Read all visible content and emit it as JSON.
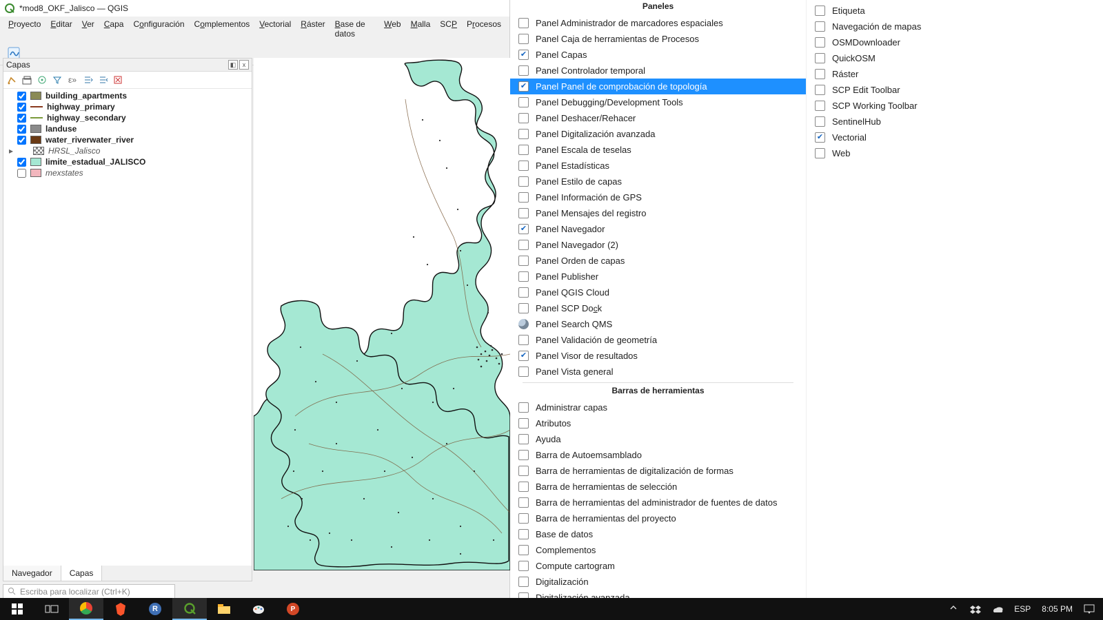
{
  "window": {
    "title": "*mod8_OKF_Jalisco — QGIS"
  },
  "menu": {
    "items": [
      "Proyecto",
      "Editar",
      "Ver",
      "Capa",
      "Configuración",
      "Complementos",
      "Vectorial",
      "Ráster",
      "Base de datos",
      "Web",
      "Malla",
      "SCP",
      "Procesos"
    ],
    "underline": [
      0,
      0,
      0,
      0,
      1,
      1,
      0,
      0,
      0,
      0,
      0,
      2,
      1
    ]
  },
  "layers_panel": {
    "title": "Capas",
    "tabs": {
      "inactive": "Navegador",
      "active": "Capas"
    },
    "search_placeholder": "Escriba para localizar (Ctrl+K)"
  },
  "layers": [
    {
      "checked": true,
      "label": "building_apartments",
      "bold": true,
      "swatch_type": "fill",
      "color": "#8a8a55"
    },
    {
      "checked": true,
      "label": "highway_primary",
      "bold": true,
      "swatch_type": "line",
      "color": "#8a3a1e"
    },
    {
      "checked": true,
      "label": "highway_secondary",
      "bold": true,
      "swatch_type": "line",
      "color": "#7a9a3a"
    },
    {
      "checked": true,
      "label": "landuse",
      "bold": true,
      "swatch_type": "fill",
      "color": "#8a8a8a"
    },
    {
      "checked": true,
      "label": "water_riverwater_river",
      "bold": true,
      "swatch_type": "fill",
      "color": "#6a3a14"
    },
    {
      "checked": null,
      "label": "HRSL_Jalisco",
      "bold": false,
      "italic": true,
      "swatch_type": "check",
      "expander": true
    },
    {
      "checked": true,
      "label": "limite_estadual_JALISCO",
      "bold": true,
      "swatch_type": "fill",
      "color": "#a5e8d3"
    },
    {
      "checked": false,
      "label": "mexstates",
      "bold": false,
      "italic": true,
      "swatch_type": "fill",
      "color": "#f2b6bd"
    }
  ],
  "panels_header": "Paneles",
  "panels": [
    {
      "checked": false,
      "label": "Panel Administrador de marcadores espaciales"
    },
    {
      "checked": false,
      "label": "Panel Caja de herramientas de Procesos"
    },
    {
      "checked": true,
      "label": "Panel Capas"
    },
    {
      "checked": false,
      "label": "Panel Controlador temporal"
    },
    {
      "checked": true,
      "label": "Panel Panel de comprobación de topología",
      "selected": true
    },
    {
      "checked": false,
      "label": "Panel Debugging/Development Tools"
    },
    {
      "checked": false,
      "label": "Panel Deshacer/Rehacer"
    },
    {
      "checked": false,
      "label": "Panel Digitalización avanzada"
    },
    {
      "checked": false,
      "label": "Panel Escala de teselas"
    },
    {
      "checked": false,
      "label": "Panel Estadísticas"
    },
    {
      "checked": false,
      "label": "Panel Estilo de capas"
    },
    {
      "checked": false,
      "label": "Panel Información de GPS"
    },
    {
      "checked": false,
      "label": "Panel Mensajes del registro"
    },
    {
      "checked": true,
      "label": "Panel Navegador"
    },
    {
      "checked": false,
      "label": "Panel Navegador (2)"
    },
    {
      "checked": false,
      "label": "Panel Orden de capas"
    },
    {
      "checked": false,
      "label": "Panel Publisher"
    },
    {
      "checked": false,
      "label": "Panel QGIS Cloud"
    },
    {
      "checked": false,
      "label": "Panel SCP Dock",
      "mnemonic_index": 12
    },
    {
      "checked": false,
      "label": "Panel Search QMS",
      "icon": "qms"
    },
    {
      "checked": false,
      "label": "Panel Validación de geometría"
    },
    {
      "checked": true,
      "label": "Panel Visor de resultados"
    },
    {
      "checked": false,
      "label": "Panel Vista general"
    }
  ],
  "toolbars_header": "Barras de herramientas",
  "toolbars": [
    {
      "checked": false,
      "label": "Administrar capas"
    },
    {
      "checked": false,
      "label": "Atributos"
    },
    {
      "checked": false,
      "label": "Ayuda"
    },
    {
      "checked": false,
      "label": "Barra de Autoemsamblado"
    },
    {
      "checked": false,
      "label": "Barra de herramientas de digitalización de formas"
    },
    {
      "checked": false,
      "label": "Barra de herramientas de selección"
    },
    {
      "checked": false,
      "label": "Barra de herramientas del administrador de fuentes de datos"
    },
    {
      "checked": false,
      "label": "Barra de herramientas del proyecto"
    },
    {
      "checked": false,
      "label": "Base de datos"
    },
    {
      "checked": false,
      "label": "Complementos"
    },
    {
      "checked": false,
      "label": "Compute cartogram"
    },
    {
      "checked": false,
      "label": "Digitalización"
    },
    {
      "checked": false,
      "label": "Digitalización avanzada"
    }
  ],
  "right_col": [
    {
      "checked": false,
      "label": "Etiqueta"
    },
    {
      "checked": false,
      "label": "Navegación de mapas"
    },
    {
      "checked": false,
      "label": "OSMDownloader"
    },
    {
      "checked": false,
      "label": "QuickOSM"
    },
    {
      "checked": false,
      "label": "Ráster"
    },
    {
      "checked": false,
      "label": "SCP Edit Toolbar"
    },
    {
      "checked": false,
      "label": "SCP Working Toolbar"
    },
    {
      "checked": false,
      "label": "SentinelHub"
    },
    {
      "checked": true,
      "label": "Vectorial"
    },
    {
      "checked": false,
      "label": "Web"
    }
  ],
  "taskbar": {
    "lang": "ESP",
    "time": "8:05 PM"
  }
}
